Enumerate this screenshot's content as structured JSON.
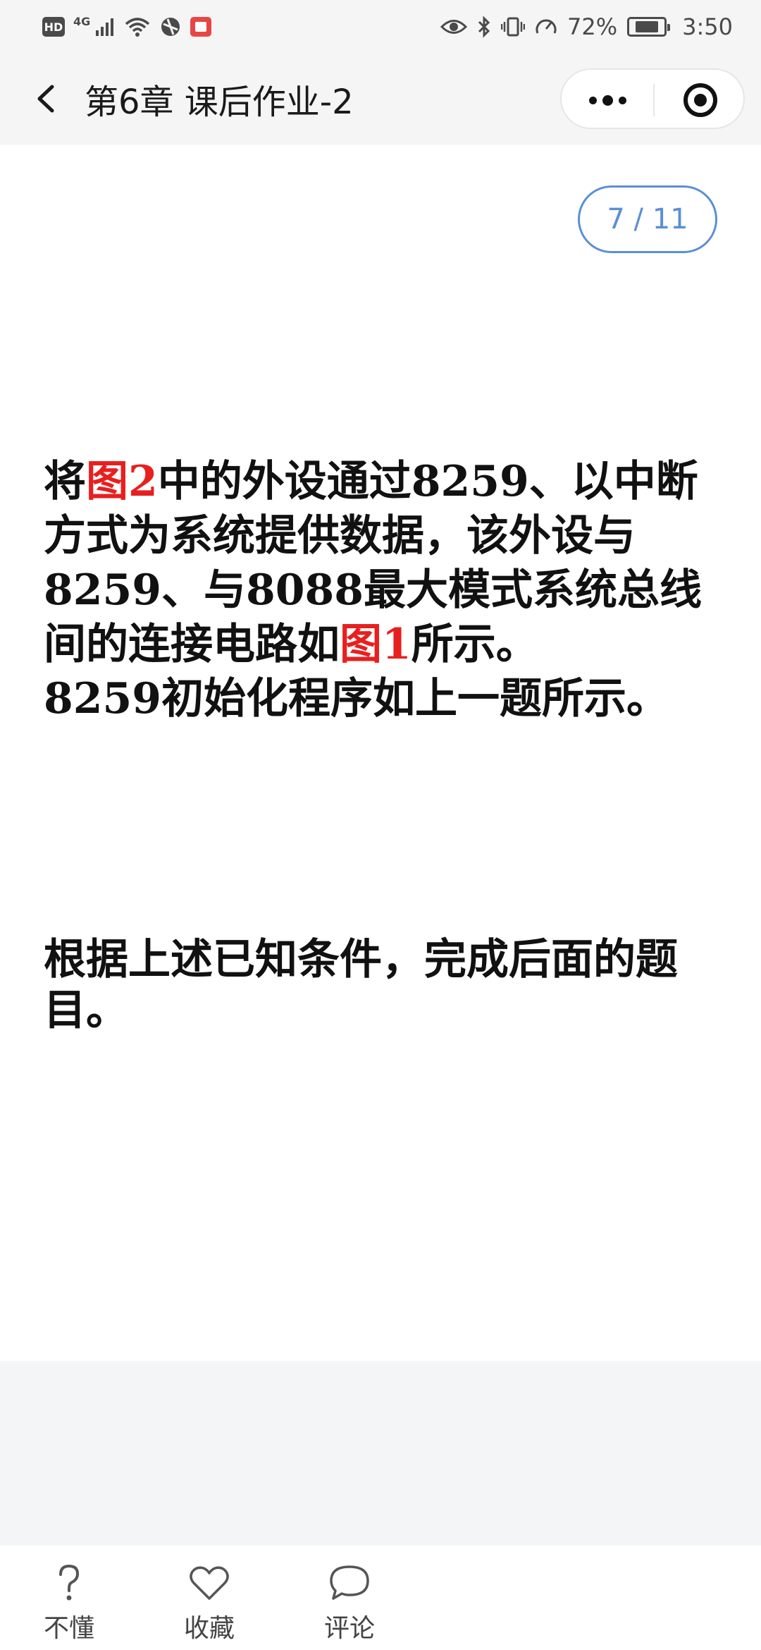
{
  "status_bar": {
    "hd": "HD",
    "network": "4G",
    "battery_percent": "72%",
    "battery_level": 0.72,
    "time": "3:50",
    "icons": [
      "hd-icon",
      "signal-icon",
      "wifi-icon",
      "browser-icon",
      "app-icon",
      "eye-icon",
      "bluetooth-icon",
      "vibrate-icon",
      "speed-icon",
      "battery-icon"
    ]
  },
  "nav": {
    "title": "第6章 课后作业-2",
    "back_icon": "chevron-left-icon",
    "more_icon": "more-dots-icon",
    "close_icon": "target-circle-icon"
  },
  "content": {
    "page_counter": "7 / 11",
    "question": {
      "segments": [
        {
          "text": "将",
          "red": false
        },
        {
          "text": "图2",
          "red": true
        },
        {
          "text": "中的外设通过8259、以中断方式为系统提供数据，该外设与8259、与8088最大模式系统总线间的连接电路如",
          "red": false
        },
        {
          "text": "图1",
          "red": true
        },
        {
          "text": "所示。",
          "red": false
        }
      ],
      "line2": "8259初始化程序如上一题所示。"
    },
    "instruction": "根据上述已知条件，完成后面的题目。",
    "colors": {
      "highlight": "#e81f1f",
      "text": "#111111",
      "accent": "#5b8fd6"
    }
  },
  "bottom_bar": {
    "items": [
      {
        "label": "不懂",
        "icon": "question-icon"
      },
      {
        "label": "收藏",
        "icon": "heart-icon"
      },
      {
        "label": "评论",
        "icon": "comment-icon"
      }
    ]
  }
}
